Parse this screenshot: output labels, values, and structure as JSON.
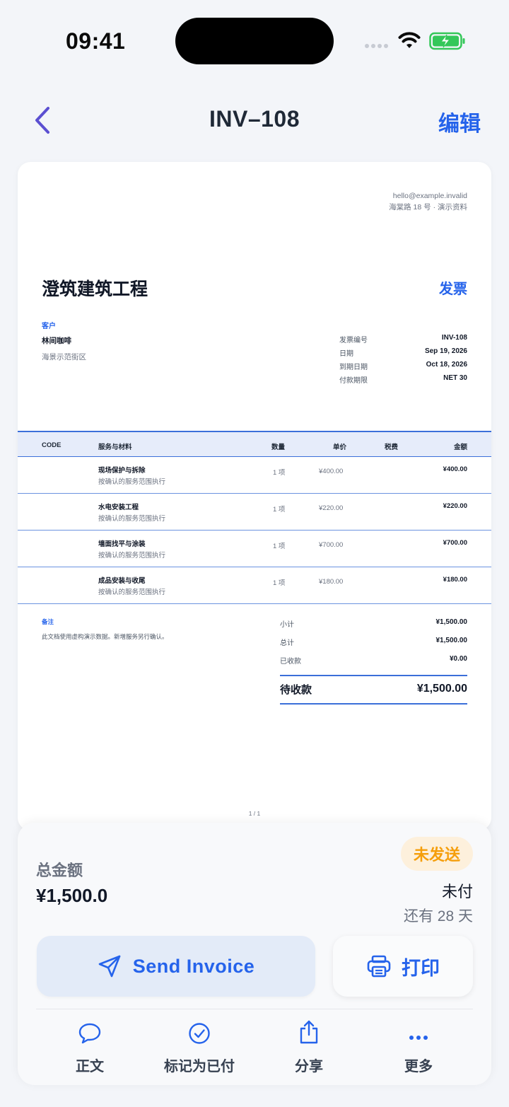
{
  "status_bar": {
    "time": "09:41"
  },
  "nav": {
    "title": "INV–108",
    "edit_label": "编辑"
  },
  "document": {
    "company_email": "hello@example.invalid",
    "company_address": "海棠路 18 号 · 演示资料",
    "company_name": "澄筑建筑工程",
    "doc_type": "发票",
    "client_label": "客户",
    "client_name": "林间咖啡",
    "client_address": "海景示范街区",
    "meta": [
      {
        "label": "发票编号",
        "value": "INV-108"
      },
      {
        "label": "日期",
        "value": "Sep 19, 2026"
      },
      {
        "label": "到期日期",
        "value": "Oct 18, 2026"
      },
      {
        "label": "付款期限",
        "value": "NET 30"
      }
    ],
    "table_headers": {
      "code": "CODE",
      "item": "服务与材料",
      "qty": "数量",
      "price": "单价",
      "tax": "税费",
      "amount": "金额"
    },
    "items": [
      {
        "name": "现场保护与拆除",
        "desc": "按确认的服务范围执行",
        "qty": "1 项",
        "price": "¥400.00",
        "amount": "¥400.00"
      },
      {
        "name": "水电安装工程",
        "desc": "按确认的服务范围执行",
        "qty": "1 项",
        "price": "¥220.00",
        "amount": "¥220.00"
      },
      {
        "name": "墙面找平与涂装",
        "desc": "按确认的服务范围执行",
        "qty": "1 项",
        "price": "¥700.00",
        "amount": "¥700.00"
      },
      {
        "name": "成品安装与收尾",
        "desc": "按确认的服务范围执行",
        "qty": "1 项",
        "price": "¥180.00",
        "amount": "¥180.00"
      }
    ],
    "notes_label": "备注",
    "notes_text": "此文档使用虚构演示数据。新增服务另行确认。",
    "totals": [
      {
        "label": "小计",
        "value": "¥1,500.00"
      },
      {
        "label": "总计",
        "value": "¥1,500.00"
      },
      {
        "label": "已收款",
        "value": "¥0.00"
      }
    ],
    "balance_label": "待收款",
    "balance_value": "¥1,500.00",
    "page_number": "1 / 1"
  },
  "sheet": {
    "total_label": "总金额",
    "total_value": "¥1,500.0",
    "status_badge": "未发送",
    "payment_status": "未付",
    "days_left": "还有 28 天",
    "send_label": "Send Invoice",
    "print_label": "打印",
    "actions": [
      {
        "label": "正文",
        "icon": "chat-bubble-icon"
      },
      {
        "label": "标记为已付",
        "icon": "check-circle-icon"
      },
      {
        "label": "分享",
        "icon": "share-icon"
      },
      {
        "label": "更多",
        "icon": "more-icon"
      }
    ]
  },
  "colors": {
    "accent": "#2563eb",
    "warning": "#f59e0b",
    "badge_bg": "#fdf0dc",
    "table_head_bg": "#e6ecfa",
    "back_arrow": "#5b4fd1"
  }
}
